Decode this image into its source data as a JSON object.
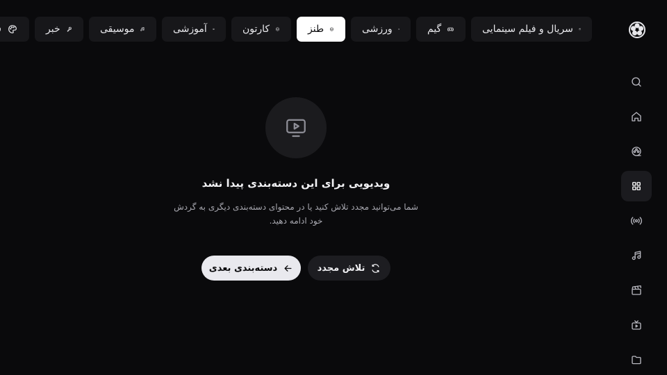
{
  "categories": [
    {
      "label": "سریال و فیلم سینمایی",
      "icon": "clapperboard-icon",
      "active": false
    },
    {
      "label": "گیم",
      "icon": "gamepad-icon",
      "active": false
    },
    {
      "label": "ورزشی",
      "icon": "volleyball-icon",
      "active": false
    },
    {
      "label": "طنز",
      "icon": "smile-icon",
      "active": true
    },
    {
      "label": "کارتون",
      "icon": "smile-icon",
      "active": false
    },
    {
      "label": "آموزشی",
      "icon": "book-open-icon",
      "active": false
    },
    {
      "label": "موسیقی",
      "icon": "music-icon",
      "active": false
    },
    {
      "label": "خبر",
      "icon": "microphone-icon",
      "active": false
    },
    {
      "label": "فر",
      "icon": "palette-icon",
      "active": false
    }
  ],
  "sidebar": {
    "items": [
      {
        "name": "search",
        "icon": "search-icon",
        "active": false
      },
      {
        "name": "home",
        "icon": "home-icon",
        "active": false
      },
      {
        "name": "film-reel",
        "icon": "film-reel-icon",
        "active": false
      },
      {
        "name": "categories",
        "icon": "grid-icon",
        "active": true
      },
      {
        "name": "live",
        "icon": "broadcast-icon",
        "active": false
      },
      {
        "name": "music",
        "icon": "music-icon",
        "active": false
      },
      {
        "name": "clapperboard",
        "icon": "clapperboard-icon",
        "active": false
      },
      {
        "name": "tv",
        "icon": "tv-icon",
        "active": false
      },
      {
        "name": "folder",
        "icon": "folder-icon",
        "active": false
      }
    ]
  },
  "empty_state": {
    "icon": "play-monitor-icon",
    "title": "ویدیویی برای این دسته‌بندی پیدا نشد",
    "description": "شما می‌توانید مجدد تلاش کنید یا در محتوای دسته‌بندی دیگری به گردش خود ادامه دهید.",
    "retry_label": "تلاش مجدد",
    "next_label": "دسته‌بندی بعدی"
  },
  "colors": {
    "background": "#0a0a0c",
    "pill": "#17171a",
    "pill_active": "#ffffff",
    "accent_button": "#e9e9ee"
  }
}
